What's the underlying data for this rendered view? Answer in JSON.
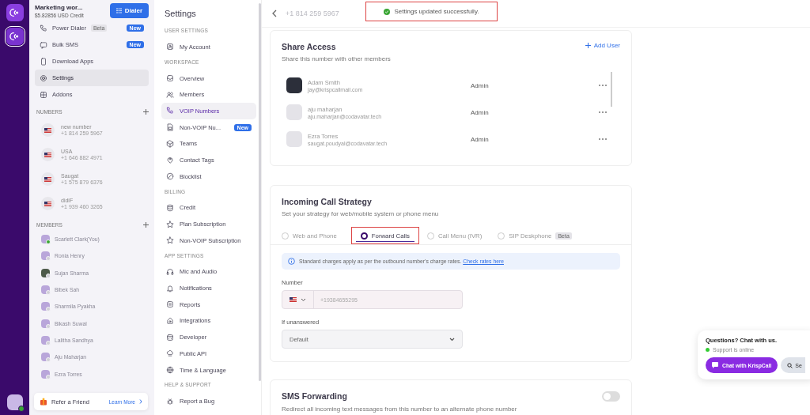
{
  "workspace": {
    "name": "Marketing wor...",
    "credit": "$5.82856 USD Credit",
    "dialer_button": "Dialer"
  },
  "sidebar": {
    "items": [
      {
        "label": "Power Dialer",
        "tag": "Beta",
        "badge": "New",
        "selected": false
      },
      {
        "label": "Bulk SMS",
        "badge": "New",
        "selected": false
      },
      {
        "label": "Download Apps",
        "selected": false
      },
      {
        "label": "Settings",
        "selected": true
      },
      {
        "label": "Addons",
        "selected": false
      }
    ],
    "numbers_heading": "NUMBERS",
    "numbers": [
      {
        "name": "new number",
        "number": "+1 814 259 5967"
      },
      {
        "name": "USA",
        "number": "+1 646 882 4971"
      },
      {
        "name": "Saugat",
        "number": "+1 575 879 6376"
      },
      {
        "name": "didiF",
        "number": "+1 939 460 3265"
      }
    ],
    "members_heading": "MEMBERS",
    "members": [
      {
        "name": "Scarlett Clark(You)",
        "online": true,
        "photo": false
      },
      {
        "name": "Ronia Henry",
        "online": false,
        "photo": false
      },
      {
        "name": "Sujan Sharma",
        "online": false,
        "photo": true
      },
      {
        "name": "Bibek Sah",
        "online": false,
        "photo": false
      },
      {
        "name": "Sharmila Pyakha",
        "online": false,
        "photo": false
      },
      {
        "name": "Bikash Suwal",
        "online": false,
        "photo": false
      },
      {
        "name": "Lalitha Sandhya",
        "online": false,
        "photo": false
      },
      {
        "name": "Aju Maharjan",
        "online": false,
        "photo": false
      },
      {
        "name": "Ezra Torres",
        "online": false,
        "photo": false
      }
    ],
    "refer": {
      "label": "Refer a Friend",
      "link": "Learn More"
    }
  },
  "settings_nav": {
    "title": "Settings",
    "sections": [
      {
        "heading": "USER SETTINGS",
        "items": [
          {
            "label": "My Account",
            "selected": false
          }
        ]
      },
      {
        "heading": "WORKSPACE",
        "items": [
          {
            "label": "Overview",
            "selected": false
          },
          {
            "label": "Members",
            "selected": false
          },
          {
            "label": "VOIP Numbers",
            "selected": true
          },
          {
            "label": "Non-VOIP Nu...",
            "badge": "New",
            "selected": false
          },
          {
            "label": "Teams",
            "selected": false
          },
          {
            "label": "Contact Tags",
            "selected": false
          },
          {
            "label": "Blocklist",
            "selected": false
          }
        ]
      },
      {
        "heading": "BILLING",
        "items": [
          {
            "label": "Credit",
            "selected": false
          },
          {
            "label": "Plan Subscription",
            "selected": false
          },
          {
            "label": "Non-VOIP Subscription",
            "selected": false
          }
        ]
      },
      {
        "heading": "APP SETTINGS",
        "items": [
          {
            "label": "Mic and Audio",
            "selected": false
          },
          {
            "label": "Notifications",
            "selected": false
          },
          {
            "label": "Reports",
            "selected": false
          },
          {
            "label": "Integrations",
            "selected": false
          },
          {
            "label": "Developer",
            "selected": false
          },
          {
            "label": "Public API",
            "selected": false
          },
          {
            "label": "Time & Language",
            "selected": false
          }
        ]
      },
      {
        "heading": "HELP & SUPPORT",
        "items": [
          {
            "label": "Report a Bug",
            "selected": false
          }
        ]
      }
    ]
  },
  "header": {
    "phone_number": "+1 814 259 5967"
  },
  "toast": {
    "message": "Settings updated successfully."
  },
  "share_access": {
    "title": "Share Access",
    "subtitle": "Share this number with other members",
    "add_button": "Add User",
    "users": [
      {
        "name": "Adam Smith",
        "email": "jay@krispcallmail.com",
        "role": "Admin",
        "photo": true
      },
      {
        "name": "aju maharjan",
        "email": "aju.maharjan@codavatar.tech",
        "role": "Admin",
        "photo": false
      },
      {
        "name": "Ezra Torres",
        "email": "saugat.poudyal@codavatar.tech",
        "role": "Admin",
        "photo": false
      }
    ]
  },
  "incoming_call_strategy": {
    "title": "Incoming Call Strategy",
    "subtitle": "Set your strategy for web/mobile system or phone menu",
    "tabs": [
      {
        "label": "Web and Phone",
        "selected": false
      },
      {
        "label": "Forward Calls",
        "selected": true
      },
      {
        "label": "Call Menu (IVR)",
        "selected": false
      },
      {
        "label": "SIP Deskphone",
        "tag": "Beta",
        "selected": false
      }
    ],
    "notice": "Standard charges apply as per the outbound number's charge rates.",
    "notice_link": "Check rates here",
    "number_label": "Number",
    "number_value": "+19384655295",
    "unanswered_label": "If unanswered",
    "unanswered_value": "Default"
  },
  "sms_forwarding": {
    "title": "SMS Forwarding",
    "subtitle": "Redirect all incoming text messages from this number to an alternate phone number",
    "on": false
  },
  "chat_widget": {
    "title": "Questions? Chat with us.",
    "status": "Support is online",
    "chat_button": "Chat with KrispCall",
    "search_button": "Se"
  }
}
